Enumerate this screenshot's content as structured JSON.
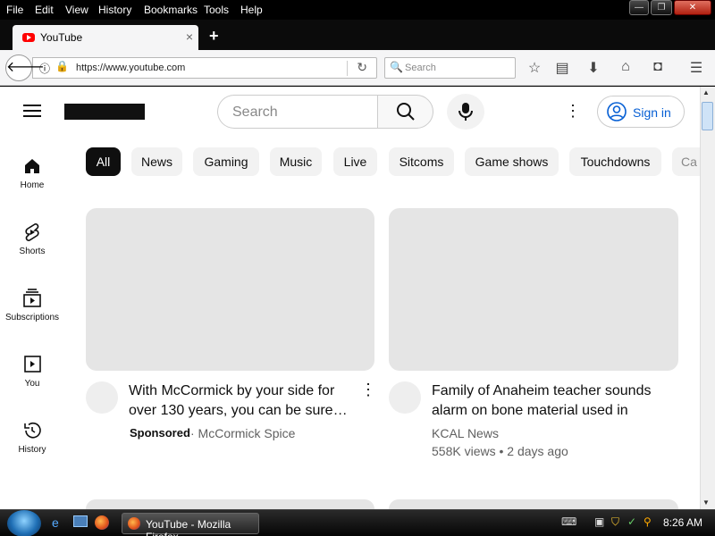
{
  "menubar": {
    "items": [
      "File",
      "Edit",
      "View",
      "History",
      "Bookmarks",
      "Tools",
      "Help"
    ],
    "window_buttons": {
      "minimize": "—",
      "maximize": "❐",
      "close": "✕"
    }
  },
  "tab": {
    "title": "YouTube",
    "close": "×",
    "new_tab": "+"
  },
  "navbar": {
    "url": "https://www.youtube.com",
    "search_placeholder": "Search"
  },
  "youtube": {
    "search_placeholder": "Search",
    "sign_in": "Sign in",
    "chips": [
      "All",
      "News",
      "Gaming",
      "Music",
      "Live",
      "Sitcoms",
      "Game shows",
      "Touchdowns",
      "Ca"
    ],
    "sidebar": [
      {
        "label": "Home",
        "icon": "home-icon"
      },
      {
        "label": "Shorts",
        "icon": "shorts-icon"
      },
      {
        "label": "Subscriptions",
        "icon": "subscriptions-icon"
      },
      {
        "label": "You",
        "icon": "you-icon"
      },
      {
        "label": "History",
        "icon": "history-icon"
      }
    ],
    "videos": [
      {
        "title_line1": "With McCormick by your side for",
        "title_line2": "over 130 years, you can be sure…",
        "sponsored": "Sponsored",
        "channel": "· McCormick Spice"
      },
      {
        "title_line1": "Family of Anaheim teacher sounds",
        "title_line2": "alarm on bone material used in",
        "channel": "KCAL News",
        "stats": "558K views • 2 days ago"
      }
    ]
  },
  "taskbar": {
    "task_label": "YouTube - Mozilla Firefox",
    "clock": "8:26 AM"
  },
  "colors": {
    "accent": "#065fd4",
    "chip_active": "#0f0f0f",
    "placeholder": "#e5e5e5"
  }
}
